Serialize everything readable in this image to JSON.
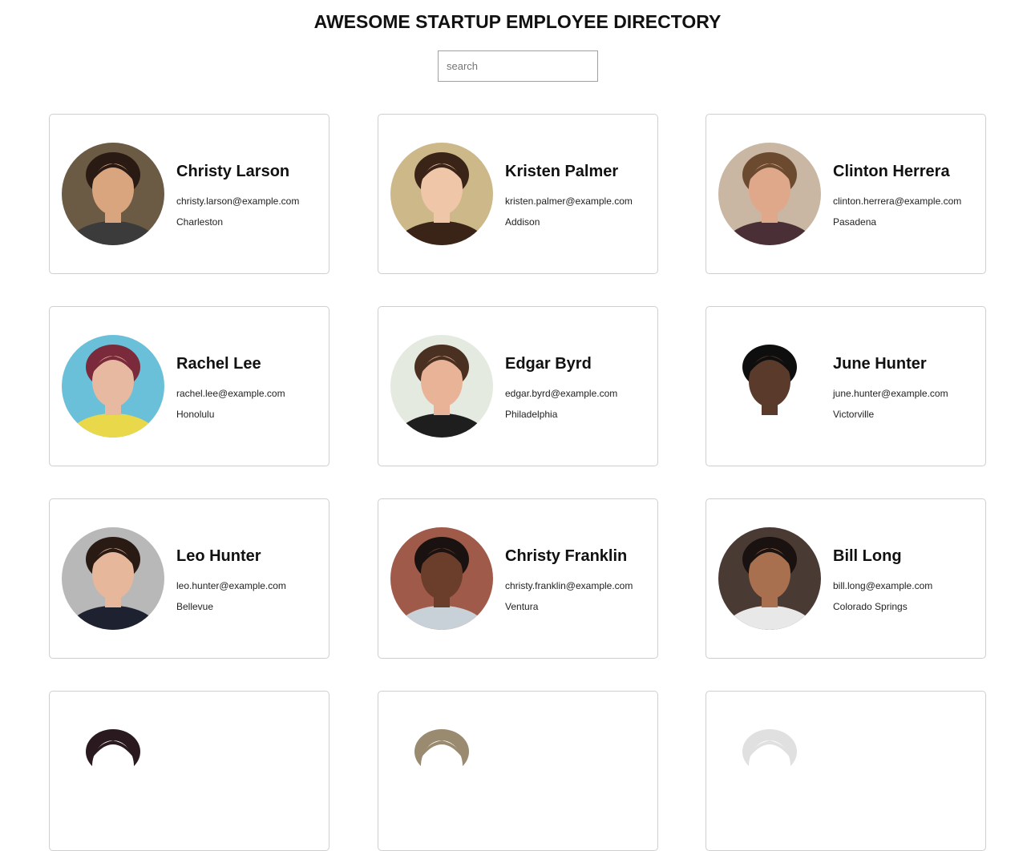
{
  "header": {
    "title": "AWESOME STARTUP EMPLOYEE DIRECTORY",
    "search_placeholder": "search"
  },
  "employees": [
    {
      "name": "Christy Larson",
      "email": "christy.larson@example.com",
      "city": "Charleston",
      "photo_colors": {
        "bg": "#6b5a44",
        "skin": "#d9a57e",
        "hair": "#2a1a14",
        "shirt": "#3b3b3b"
      }
    },
    {
      "name": "Kristen Palmer",
      "email": "kristen.palmer@example.com",
      "city": "Addison",
      "photo_colors": {
        "bg": "#cdb88a",
        "skin": "#f0c6a8",
        "hair": "#3a2418",
        "shirt": "#3a2418"
      }
    },
    {
      "name": "Clinton Herrera",
      "email": "clinton.herrera@example.com",
      "city": "Pasadena",
      "photo_colors": {
        "bg": "#c9b7a4",
        "skin": "#e0a88a",
        "hair": "#6b4a30",
        "shirt": "#4a3036"
      }
    },
    {
      "name": "Rachel Lee",
      "email": "rachel.lee@example.com",
      "city": "Honolulu",
      "photo_colors": {
        "bg": "#69c0d8",
        "skin": "#e7b9a0",
        "hair": "#7a2a3a",
        "shirt": "#e8d84a"
      }
    },
    {
      "name": "Edgar Byrd",
      "email": "edgar.byrd@example.com",
      "city": "Philadelphia",
      "photo_colors": {
        "bg": "#e4eae0",
        "skin": "#e9b397",
        "hair": "#4a3020",
        "shirt": "#1e1e1e"
      }
    },
    {
      "name": "June Hunter",
      "email": "june.hunter@example.com",
      "city": "Victorville",
      "photo_colors": {
        "bg": "#ffffff",
        "skin": "#5a3a2a",
        "hair": "#0e0e0e",
        "shirt": "#ffffff"
      }
    },
    {
      "name": "Leo Hunter",
      "email": "leo.hunter@example.com",
      "city": "Bellevue",
      "photo_colors": {
        "bg": "#b8b8b8",
        "skin": "#e6b79a",
        "hair": "#2a1a14",
        "shirt": "#1e2230"
      }
    },
    {
      "name": "Christy Franklin",
      "email": "christy.franklin@example.com",
      "city": "Ventura",
      "photo_colors": {
        "bg": "#a05a4a",
        "skin": "#6a3e2a",
        "hair": "#1a1210",
        "shirt": "#c8d0d8"
      }
    },
    {
      "name": "Bill Long",
      "email": "bill.long@example.com",
      "city": "Colorado Springs",
      "photo_colors": {
        "bg": "#4a3a34",
        "skin": "#a8704e",
        "hair": "#1a1210",
        "shirt": "#e8e8e8"
      }
    },
    {
      "name": "",
      "email": "",
      "city": "",
      "photo_colors": {
        "bg": "#ffffff",
        "skin": "#ffffff",
        "hair": "#2a1a20",
        "shirt": "#ffffff"
      }
    },
    {
      "name": "",
      "email": "",
      "city": "",
      "photo_colors": {
        "bg": "#ffffff",
        "skin": "#ffffff",
        "hair": "#9a8a70",
        "shirt": "#ffffff"
      }
    },
    {
      "name": "",
      "email": "",
      "city": "",
      "photo_colors": {
        "bg": "#ffffff",
        "skin": "#ffffff",
        "hair": "#e0e0e0",
        "shirt": "#ffffff"
      }
    }
  ]
}
